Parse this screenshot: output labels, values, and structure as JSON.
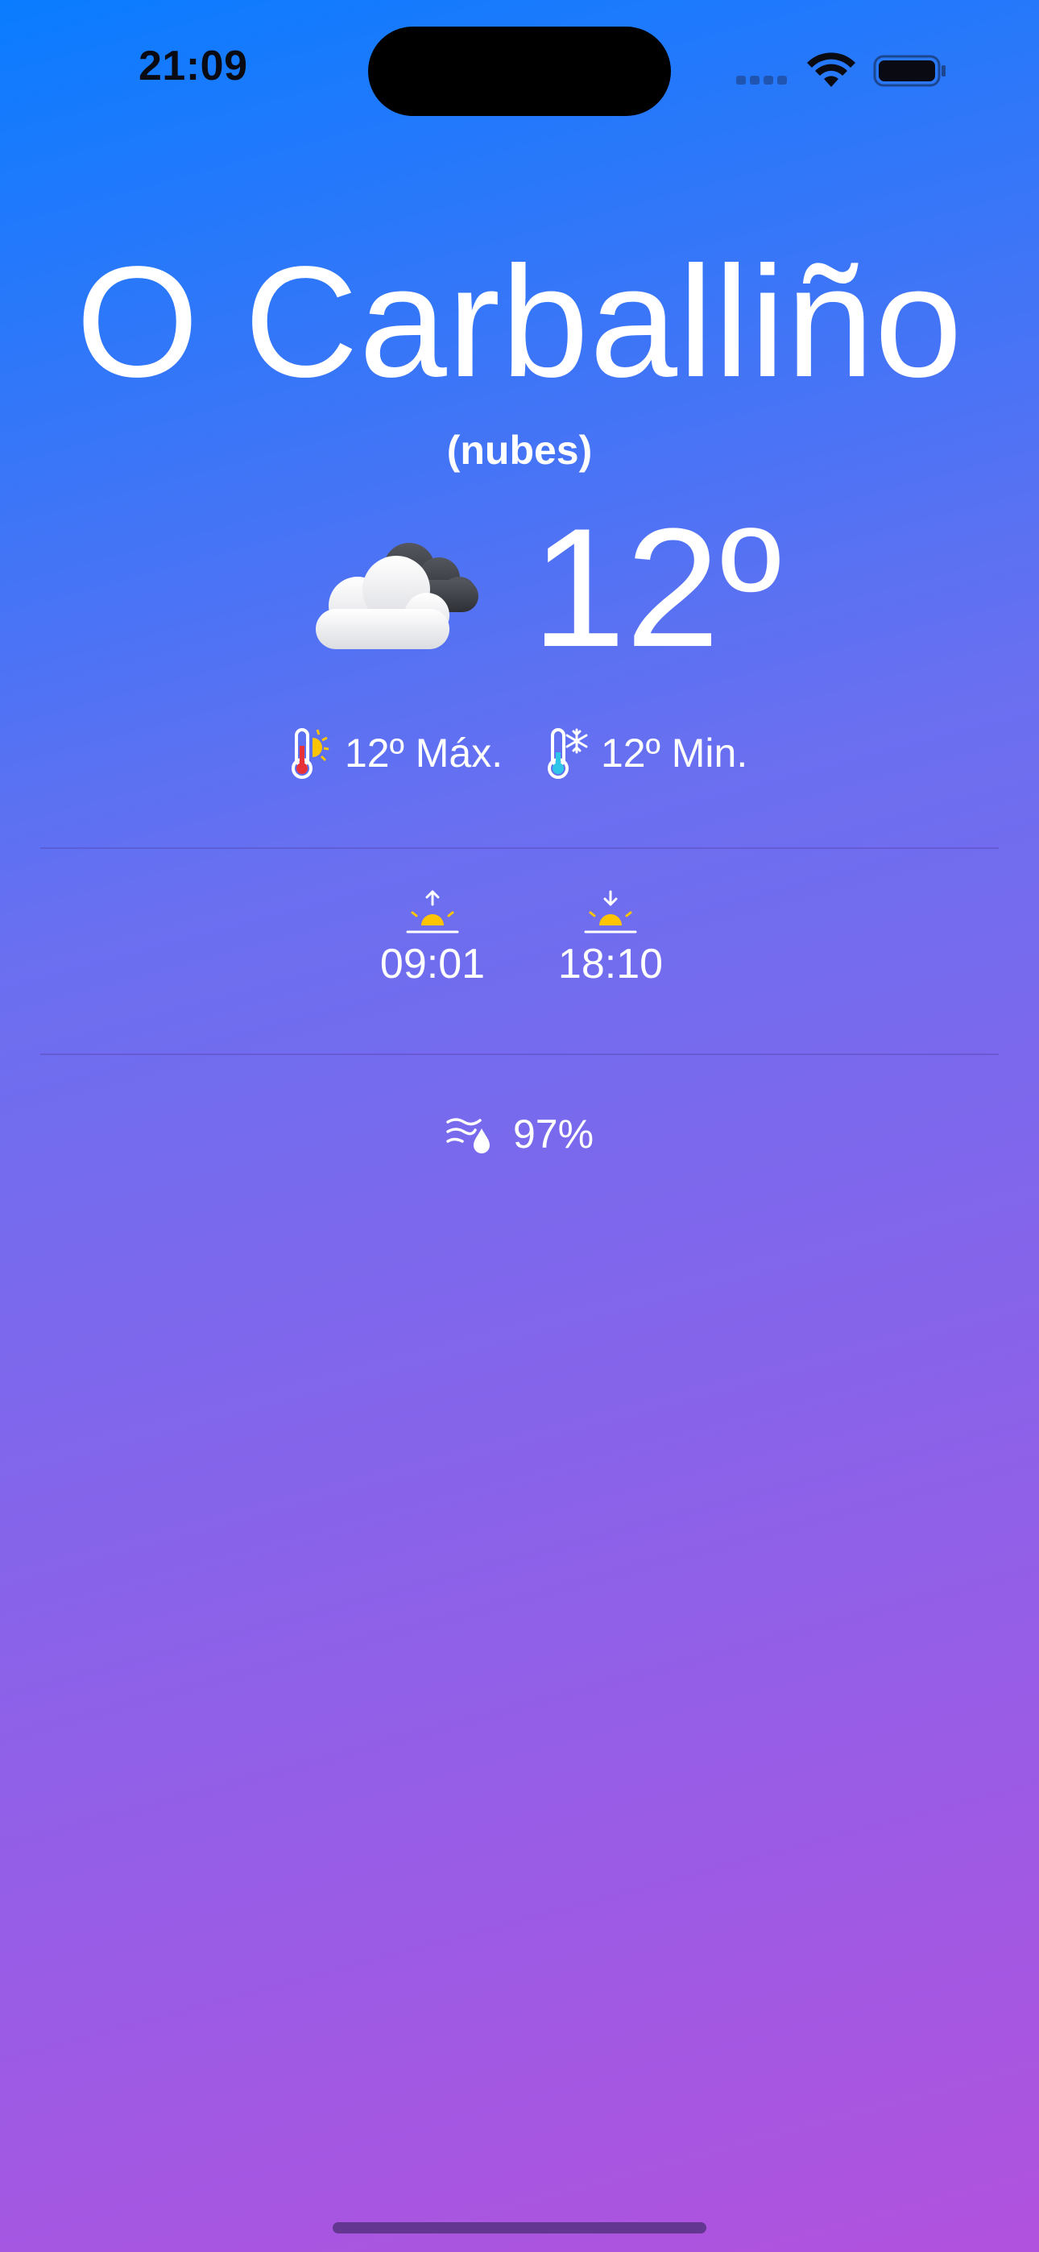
{
  "status_bar": {
    "time": "21:09"
  },
  "weather": {
    "city": "O Carballiño",
    "condition": "(nubes)",
    "condition_icon": "cloud-icon",
    "temperature": "12º",
    "max_label": "12º Máx.",
    "min_label": "12º Min.",
    "sunrise": "09:01",
    "sunset": "18:10",
    "humidity": "97%"
  },
  "colors": {
    "gradient_top": "#0a7cff",
    "gradient_bottom": "#b152de",
    "sun_yellow": "#ffc400",
    "text": "#ffffff"
  }
}
